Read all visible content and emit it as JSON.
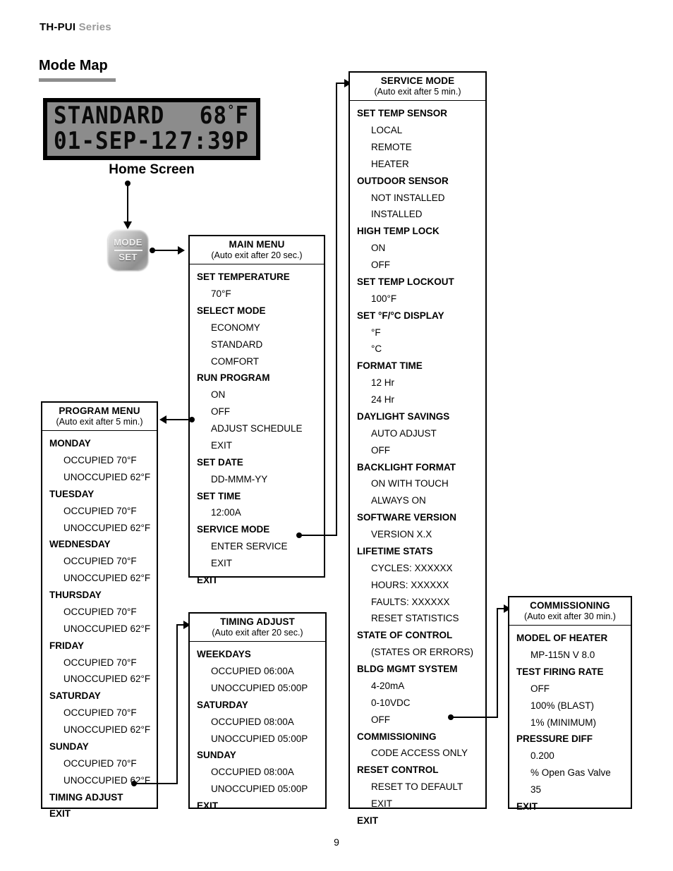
{
  "header": {
    "brand": "TH-PUI",
    "series": "Series",
    "page_title": "Mode Map"
  },
  "lcd": {
    "mode": "STANDARD",
    "temperature": "68",
    "temp_degree": "°",
    "temp_unit": "F",
    "date": "01-SEP-12",
    "time": "7:39P",
    "caption": "Home Screen"
  },
  "mode_set_button": {
    "top_label": "MODE",
    "bottom_label": "SET"
  },
  "main_menu": {
    "title": "MAIN MENU",
    "subtitle": "(Auto exit after 20 sec.)",
    "items": [
      {
        "label": "SET TEMPERATURE",
        "level": 0
      },
      {
        "label": "70°F",
        "level": 1
      },
      {
        "label": "SELECT MODE",
        "level": 0
      },
      {
        "label": "ECONOMY",
        "level": 1
      },
      {
        "label": "STANDARD",
        "level": 1
      },
      {
        "label": "COMFORT",
        "level": 1
      },
      {
        "label": "RUN PROGRAM",
        "level": 0
      },
      {
        "label": "ON",
        "level": 1
      },
      {
        "label": "OFF",
        "level": 1
      },
      {
        "label": "ADJUST SCHEDULE",
        "level": 1
      },
      {
        "label": "EXIT",
        "level": 1
      },
      {
        "label": "SET DATE",
        "level": 0
      },
      {
        "label": "DD-MMM-YY",
        "level": 1
      },
      {
        "label": "SET TIME",
        "level": 0
      },
      {
        "label": "12:00A",
        "level": 1
      },
      {
        "label": "SERVICE MODE",
        "level": 0
      },
      {
        "label": "ENTER SERVICE",
        "level": 1
      },
      {
        "label": "EXIT",
        "level": 1
      },
      {
        "label": "EXIT",
        "level": 0
      }
    ]
  },
  "service_mode": {
    "title": "SERVICE MODE",
    "subtitle": "(Auto exit after 5 min.)",
    "items": [
      {
        "label": "SET TEMP SENSOR",
        "level": 0
      },
      {
        "label": "LOCAL",
        "level": 1
      },
      {
        "label": "REMOTE",
        "level": 1
      },
      {
        "label": "HEATER",
        "level": 1
      },
      {
        "label": "OUTDOOR SENSOR",
        "level": 0
      },
      {
        "label": "NOT INSTALLED",
        "level": 1
      },
      {
        "label": "INSTALLED",
        "level": 1
      },
      {
        "label": "HIGH TEMP LOCK",
        "level": 0
      },
      {
        "label": "ON",
        "level": 1
      },
      {
        "label": "OFF",
        "level": 1
      },
      {
        "label": "SET TEMP LOCKOUT",
        "level": 0
      },
      {
        "label": "100°F",
        "level": 1
      },
      {
        "label": "SET °F/°C DISPLAY",
        "level": 0
      },
      {
        "label": "°F",
        "level": 1
      },
      {
        "label": "°C",
        "level": 1
      },
      {
        "label": "FORMAT TIME",
        "level": 0
      },
      {
        "label": "12 Hr",
        "level": 1
      },
      {
        "label": "24 Hr",
        "level": 1
      },
      {
        "label": "DAYLIGHT SAVINGS",
        "level": 0
      },
      {
        "label": "AUTO ADJUST",
        "level": 1
      },
      {
        "label": "OFF",
        "level": 1
      },
      {
        "label": "BACKLIGHT FORMAT",
        "level": 0
      },
      {
        "label": "ON WITH TOUCH",
        "level": 1
      },
      {
        "label": "ALWAYS ON",
        "level": 1
      },
      {
        "label": "SOFTWARE VERSION",
        "level": 0
      },
      {
        "label": "VERSION X.X",
        "level": 1
      },
      {
        "label": "LIFETIME STATS",
        "level": 0
      },
      {
        "label": "CYCLES: XXXXXX",
        "level": 1
      },
      {
        "label": "HOURS: XXXXXX",
        "level": 1
      },
      {
        "label": "FAULTS: XXXXXX",
        "level": 1
      },
      {
        "label": "RESET STATISTICS",
        "level": 1
      },
      {
        "label": "STATE OF CONTROL",
        "level": 0
      },
      {
        "label": "(STATES OR ERRORS)",
        "level": 1
      },
      {
        "label": "BLDG MGMT SYSTEM",
        "level": 0
      },
      {
        "label": "4-20mA",
        "level": 1
      },
      {
        "label": "0-10VDC",
        "level": 1
      },
      {
        "label": "OFF",
        "level": 1
      },
      {
        "label": "COMMISSIONING",
        "level": 0
      },
      {
        "label": "CODE ACCESS ONLY",
        "level": 1
      },
      {
        "label": "RESET CONTROL",
        "level": 0
      },
      {
        "label": "RESET TO DEFAULT",
        "level": 1
      },
      {
        "label": "EXIT",
        "level": 1
      },
      {
        "label": "EXIT",
        "level": 0
      }
    ]
  },
  "program_menu": {
    "title": "PROGRAM MENU",
    "subtitle": "(Auto exit after 5 min.)",
    "items": [
      {
        "label": "MONDAY",
        "level": 0
      },
      {
        "label": "OCCUPIED 70°F",
        "level": 1
      },
      {
        "label": "UNOCCUPIED 62°F",
        "level": 1
      },
      {
        "label": "TUESDAY",
        "level": 0
      },
      {
        "label": "OCCUPIED 70°F",
        "level": 1
      },
      {
        "label": "UNOCCUPIED 62°F",
        "level": 1
      },
      {
        "label": "WEDNESDAY",
        "level": 0
      },
      {
        "label": "OCCUPIED 70°F",
        "level": 1
      },
      {
        "label": "UNOCCUPIED 62°F",
        "level": 1
      },
      {
        "label": "THURSDAY",
        "level": 0
      },
      {
        "label": "OCCUPIED 70°F",
        "level": 1
      },
      {
        "label": "UNOCCUPIED 62°F",
        "level": 1
      },
      {
        "label": "FRIDAY",
        "level": 0
      },
      {
        "label": "OCCUPIED 70°F",
        "level": 1
      },
      {
        "label": "UNOCCUPIED 62°F",
        "level": 1
      },
      {
        "label": "SATURDAY",
        "level": 0
      },
      {
        "label": "OCCUPIED 70°F",
        "level": 1
      },
      {
        "label": "UNOCCUPIED 62°F",
        "level": 1
      },
      {
        "label": "SUNDAY",
        "level": 0
      },
      {
        "label": "OCCUPIED 70°F",
        "level": 1
      },
      {
        "label": "UNOCCUPIED 62°F",
        "level": 1
      },
      {
        "label": "TIMING ADJUST",
        "level": 0
      },
      {
        "label": "EXIT",
        "level": 0
      }
    ]
  },
  "timing_adjust": {
    "title": "TIMING ADJUST",
    "subtitle": "(Auto exit after 20 sec.)",
    "items": [
      {
        "label": "WEEKDAYS",
        "level": 0
      },
      {
        "label": "OCCUPIED 06:00A",
        "level": 1
      },
      {
        "label": "UNOCCUPIED 05:00P",
        "level": 1
      },
      {
        "label": "SATURDAY",
        "level": 0
      },
      {
        "label": "OCCUPIED 08:00A",
        "level": 1
      },
      {
        "label": "UNOCCUPIED 05:00P",
        "level": 1
      },
      {
        "label": "SUNDAY",
        "level": 0
      },
      {
        "label": "OCCUPIED 08:00A",
        "level": 1
      },
      {
        "label": "UNOCCUPIED 05:00P",
        "level": 1
      },
      {
        "label": "EXIT",
        "level": 0
      }
    ]
  },
  "commissioning": {
    "title": "COMMISSIONING",
    "subtitle": "(Auto exit after 30 min.)",
    "items": [
      {
        "label": "MODEL OF HEATER",
        "level": 0
      },
      {
        "label": "MP-115N V 8.0",
        "level": 1
      },
      {
        "label": "TEST FIRING RATE",
        "level": 0
      },
      {
        "label": "OFF",
        "level": 1
      },
      {
        "label": "100% (BLAST)",
        "level": 1
      },
      {
        "label": "1% (MINIMUM)",
        "level": 1
      },
      {
        "label": "PRESSURE DIFF",
        "level": 0
      },
      {
        "label": "0.200",
        "level": 1
      },
      {
        "label": "% Open Gas Valve",
        "level": 1
      },
      {
        "label": "35",
        "level": 1
      },
      {
        "label": "EXIT",
        "level": 0
      }
    ]
  },
  "footer": {
    "page_number": "9"
  },
  "colors": {
    "lcd_background": "#8c8c8c",
    "lcd_bezel": "#000000",
    "title_rule": "#8d8d8d",
    "series_text": "#9a9a9a",
    "line": "#000000"
  }
}
